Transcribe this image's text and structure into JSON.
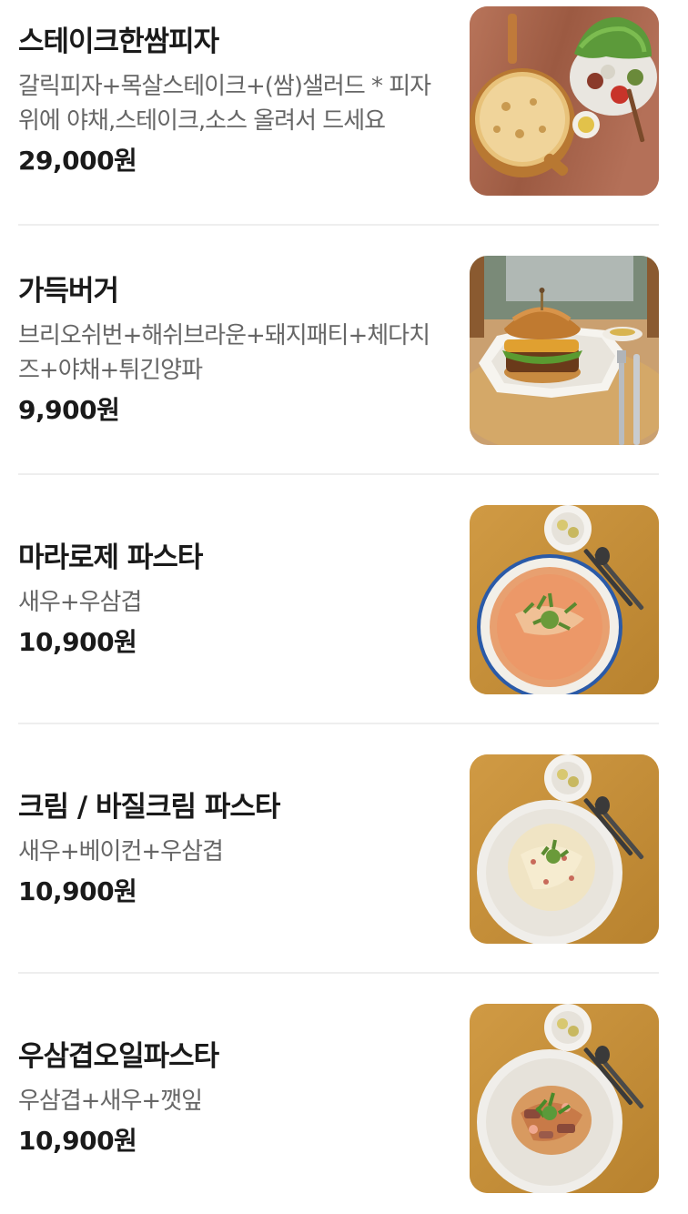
{
  "menu": {
    "items": [
      {
        "title": "스테이크한쌈피자",
        "description": "갈릭피자+목살스테이크+(쌈)샐러드 * 피자위에 야채,스테이크,소스 올려서 드세요",
        "price": "29,000원",
        "image_icon": "steak-pizza-photo"
      },
      {
        "title": "가득버거",
        "description": "브리오쉬번+해쉬브라운+돼지패티+체다치즈+야채+튀긴양파",
        "price": "9,900원",
        "image_icon": "burger-photo"
      },
      {
        "title": "마라로제 파스타",
        "description": "새우+우삼겹",
        "price": "10,900원",
        "image_icon": "mala-rose-pasta-photo"
      },
      {
        "title": "크림 / 바질크림 파스타",
        "description": "새우+베이컨+우삼겹",
        "price": "10,900원",
        "image_icon": "cream-pasta-photo"
      },
      {
        "title": "우삼겹오일파스타",
        "description": "우삼겹+새우+깻잎",
        "price": "10,900원",
        "image_icon": "oil-pasta-photo"
      }
    ]
  }
}
